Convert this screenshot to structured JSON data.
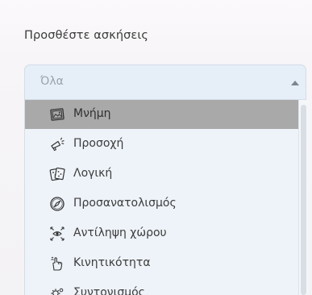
{
  "heading": "Προσθέστε ασκήσεις",
  "select": {
    "value": "Όλα",
    "caret_icon": "caret-up-icon"
  },
  "menu": {
    "items": [
      {
        "label": "Μνήμη",
        "icon": "memory-photo-icon",
        "selected": true
      },
      {
        "label": "Προσοχή",
        "icon": "megaphone-icon",
        "selected": false
      },
      {
        "label": "Λογική",
        "icon": "dice-cards-icon",
        "selected": false
      },
      {
        "label": "Προσανατολισμός",
        "icon": "compass-icon",
        "selected": false
      },
      {
        "label": "Αντίληψη χώρου",
        "icon": "eye-arrows-icon",
        "selected": false
      },
      {
        "label": "Κινητικότητα",
        "icon": "hand-gesture-icon",
        "selected": false
      },
      {
        "label": "Συντονισμός",
        "icon": "gear-icon",
        "selected": false
      }
    ]
  },
  "colors": {
    "select_bg": "#e6eef7",
    "menu_bg": "#eef3f9",
    "selected_item_bg": "#a9a9a9"
  }
}
